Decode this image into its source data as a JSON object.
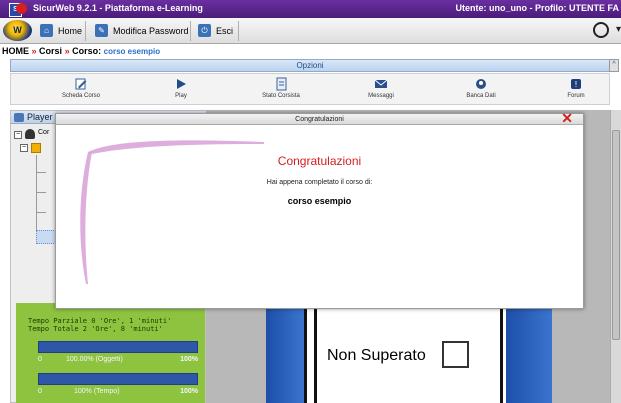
{
  "app": {
    "title": "SicurWeb 9.2.1 - Piattaforma e-Learning",
    "user_info": "Utente: uno_uno - Profilo: UTENTE FA",
    "logo_letter": "S",
    "secondary_logo_letter": "W"
  },
  "toolbar": {
    "home_label": "Home",
    "change_password_label": "Modifica Password",
    "logout_label": "Esci"
  },
  "breadcrumb": {
    "home": "HOME",
    "separator": "»",
    "courses": "Corsi",
    "course_label": "Corso:",
    "course_name": "corso esempio"
  },
  "options": {
    "title": "Opzioni",
    "items": [
      {
        "label": "Scheda Corso",
        "icon": "edit-icon"
      },
      {
        "label": "Play",
        "icon": "play-icon"
      },
      {
        "label": "Stato Corsista",
        "icon": "document-icon"
      },
      {
        "label": "Messaggi",
        "icon": "envelope-icon"
      },
      {
        "label": "Banca Dati",
        "icon": "database-icon"
      },
      {
        "label": "Forum",
        "icon": "forum-icon"
      }
    ]
  },
  "player": {
    "header": "Player",
    "tree_root": "Cor"
  },
  "stats": {
    "partial_time": "Tempo Parziale  0 'Ore', 1 'minuti'",
    "total_time": "Tempo Totale    2 'Ore', 8 'minuti'",
    "objects_progress": {
      "start": "0",
      "center": "100.00% (Oggetti)",
      "end": "100%",
      "value": 1.0
    },
    "time_progress": {
      "start": "0",
      "center": "100% (Tempo)",
      "end": "100%",
      "value": 1.0
    }
  },
  "result": {
    "text": "Non Superato"
  },
  "dialog": {
    "title": "Congratulazioni",
    "heading": "Congratulazioni",
    "message": "Hai appena completato il corso di:",
    "course": "corso esempio",
    "close": "✕"
  },
  "colors": {
    "title_bar": "#4b1c7a",
    "accent_red": "#d42020",
    "stats_green": "#8dc33e",
    "progress_blue": "#2f57a8"
  }
}
